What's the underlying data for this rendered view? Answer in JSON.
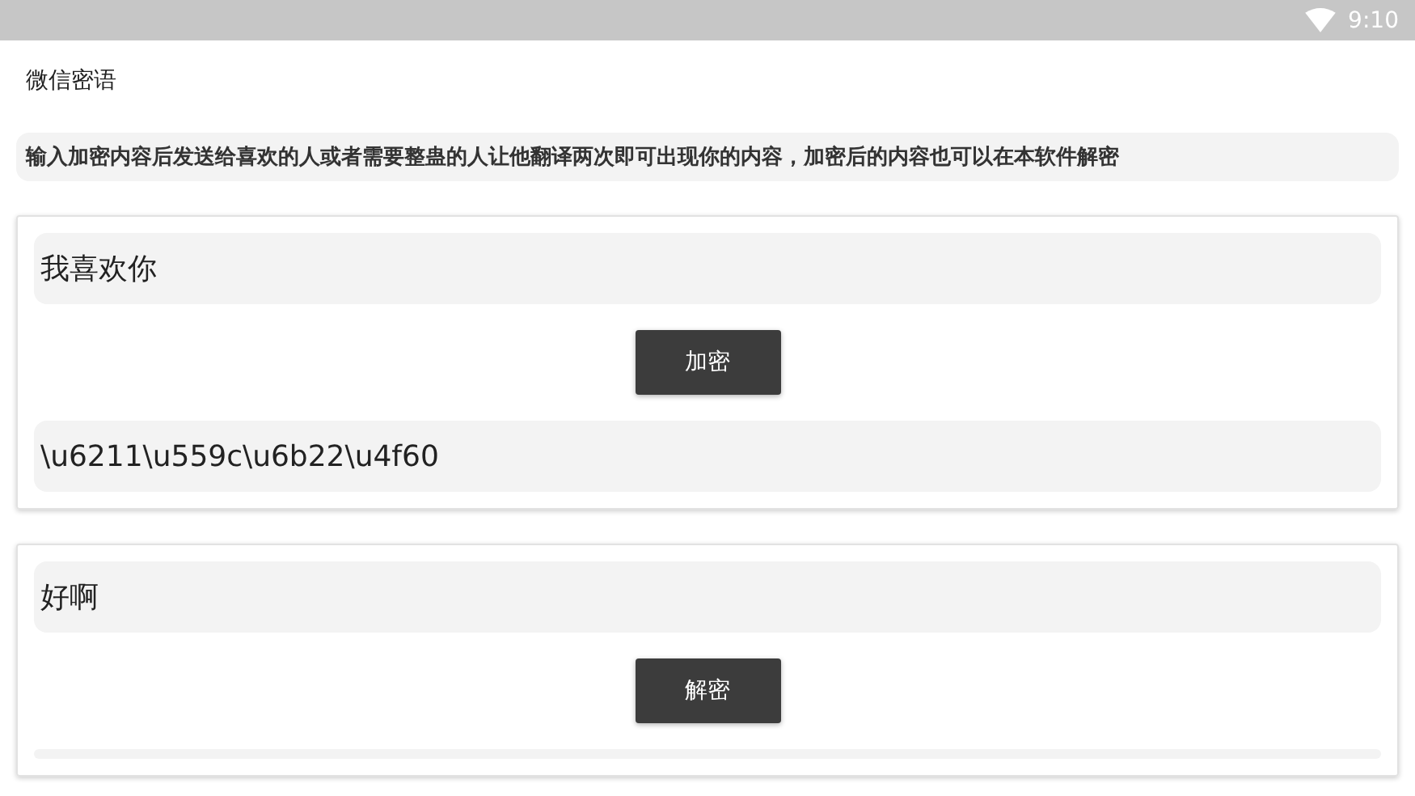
{
  "status_bar": {
    "time": "9:10"
  },
  "app_bar": {
    "title": "微信密语"
  },
  "description": "输入加密内容后发送给喜欢的人或者需要整蛊的人让他翻译两次即可出现你的内容，加密后的内容也可以在本软件解密",
  "cards": [
    {
      "input": "我喜欢你",
      "button": "加密",
      "output": "\\u6211\\u559c\\u6b22\\u4f60"
    },
    {
      "input": "好啊",
      "button": "解密"
    }
  ]
}
